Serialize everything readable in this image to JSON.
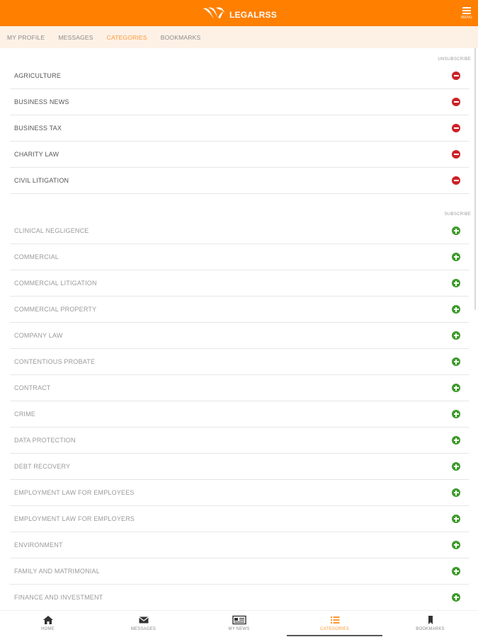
{
  "header": {
    "brand": "LEGALRSS",
    "menu_label": "MENU"
  },
  "subnav": {
    "items": [
      {
        "label": "MY PROFILE",
        "active": false
      },
      {
        "label": "MESSAGES",
        "active": false
      },
      {
        "label": "CATEGORIES",
        "active": true
      },
      {
        "label": "BOOKMARKS",
        "active": false
      }
    ]
  },
  "subscribed": {
    "section_label": "UNSUBSCRIBE",
    "items": [
      "AGRICULTURE",
      "BUSINESS NEWS",
      "BUSINESS TAX",
      "CHARITY LAW",
      "CIVIL LITIGATION"
    ]
  },
  "available": {
    "section_label": "SUBSCRIBE",
    "items": [
      "CLINICAL NEGLIGENCE",
      "COMMERCIAL",
      "COMMERCIAL LITIGATION",
      "COMMERCIAL PROPERTY",
      "COMPANY LAW",
      "CONTENTIOUS PROBATE",
      "CONTRACT",
      "CRIME",
      "DATA PROTECTION",
      "DEBT RECOVERY",
      "EMPLOYMENT LAW FOR EMPLOYEES",
      "EMPLOYMENT LAW FOR EMPLOYERS",
      "ENVIRONMENT",
      "FAMILY AND MATRIMONIAL",
      "FINANCE AND INVESTMENT"
    ]
  },
  "bottom_nav": {
    "tabs": [
      {
        "label": "HOME",
        "icon": "home-icon",
        "active": false
      },
      {
        "label": "MESSAGES",
        "icon": "envelope-icon",
        "active": false
      },
      {
        "label": "MY NEWS",
        "icon": "newspaper-icon",
        "active": false
      },
      {
        "label": "CATEGORIES",
        "icon": "list-icon",
        "active": true
      },
      {
        "label": "BOOKMARKS",
        "icon": "bookmark-icon",
        "active": false
      }
    ]
  },
  "colors": {
    "brand_orange": "#ff7f00",
    "active_tab": "#ff9933",
    "unsubscribe_red": "#cc2229",
    "subscribe_green": "#3c9a2a",
    "subnav_bg": "#fdf1e6"
  }
}
